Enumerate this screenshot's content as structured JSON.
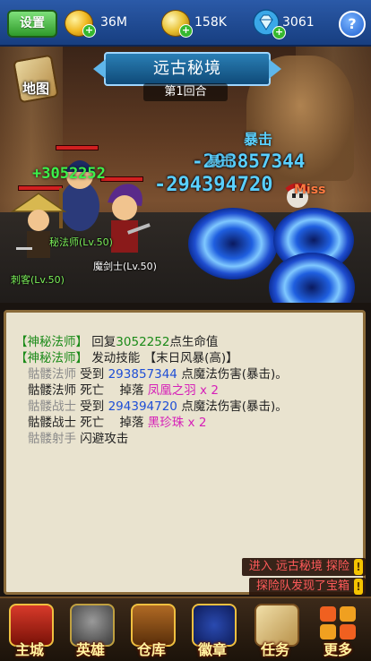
{
  "topbar": {
    "settings_label": "设置",
    "gold": "36M",
    "coupons": "158K",
    "diamonds": "3061",
    "help_label": "?"
  },
  "battle": {
    "title": "远古秘境",
    "round": "第1回合",
    "map_label": "地图",
    "heal_text": "+3052252",
    "crit_label_1": "暴击",
    "crit_label_2": "暴击",
    "damage_1": "-293857344",
    "damage_2": "-294394720",
    "miss_label": "Miss",
    "units": [
      {
        "name": "秘法师(Lv.50)"
      },
      {
        "name": "魔剑士(Lv.50)"
      },
      {
        "name": "刺客(Lv.50)"
      }
    ]
  },
  "log": {
    "lines": [
      {
        "a": "【神秘法师】",
        "b": "回复",
        "c": "3052252",
        "d": "点生命值"
      },
      {
        "a": "【神秘法师】",
        "b": "发动技能",
        "c": "【末日风暴(高)】"
      },
      {
        "a": "骷髅法师",
        "b": "受到",
        "c": "293857344",
        "d": "点魔法伤害(暴击)。"
      },
      {
        "a": "骷髅法师",
        "b": "死亡",
        "c": "掉落",
        "d": "凤凰之羽 x 2"
      },
      {
        "a": "骷髅战士",
        "b": "受到",
        "c": "294394720",
        "d": "点魔法伤害(暴击)。"
      },
      {
        "a": "骷髅战士",
        "b": "死亡",
        "c": "掉落",
        "d": "黑珍珠 x 2"
      },
      {
        "a": "骷髅射手",
        "b": "闪避攻击"
      }
    ]
  },
  "notifications": [
    {
      "text": "进入 远古秘境 探险",
      "icon": "!"
    },
    {
      "text": "探险队发现了宝箱",
      "icon": "!"
    }
  ],
  "nav": [
    {
      "label": "主城",
      "icon": "castle-icon"
    },
    {
      "label": "英雄",
      "icon": "helmet-icon"
    },
    {
      "label": "仓库",
      "icon": "chest-icon"
    },
    {
      "label": "徽章",
      "icon": "emblem-icon"
    },
    {
      "label": "任务",
      "icon": "scroll-icon"
    },
    {
      "label": "更多",
      "icon": "grid-icon"
    }
  ],
  "colors": {
    "heal": "#3cf04a",
    "damage": "#5ad0ff",
    "log_green": "#1a8a18",
    "log_blue": "#1f4fd6",
    "log_pink": "#d61fb8"
  }
}
